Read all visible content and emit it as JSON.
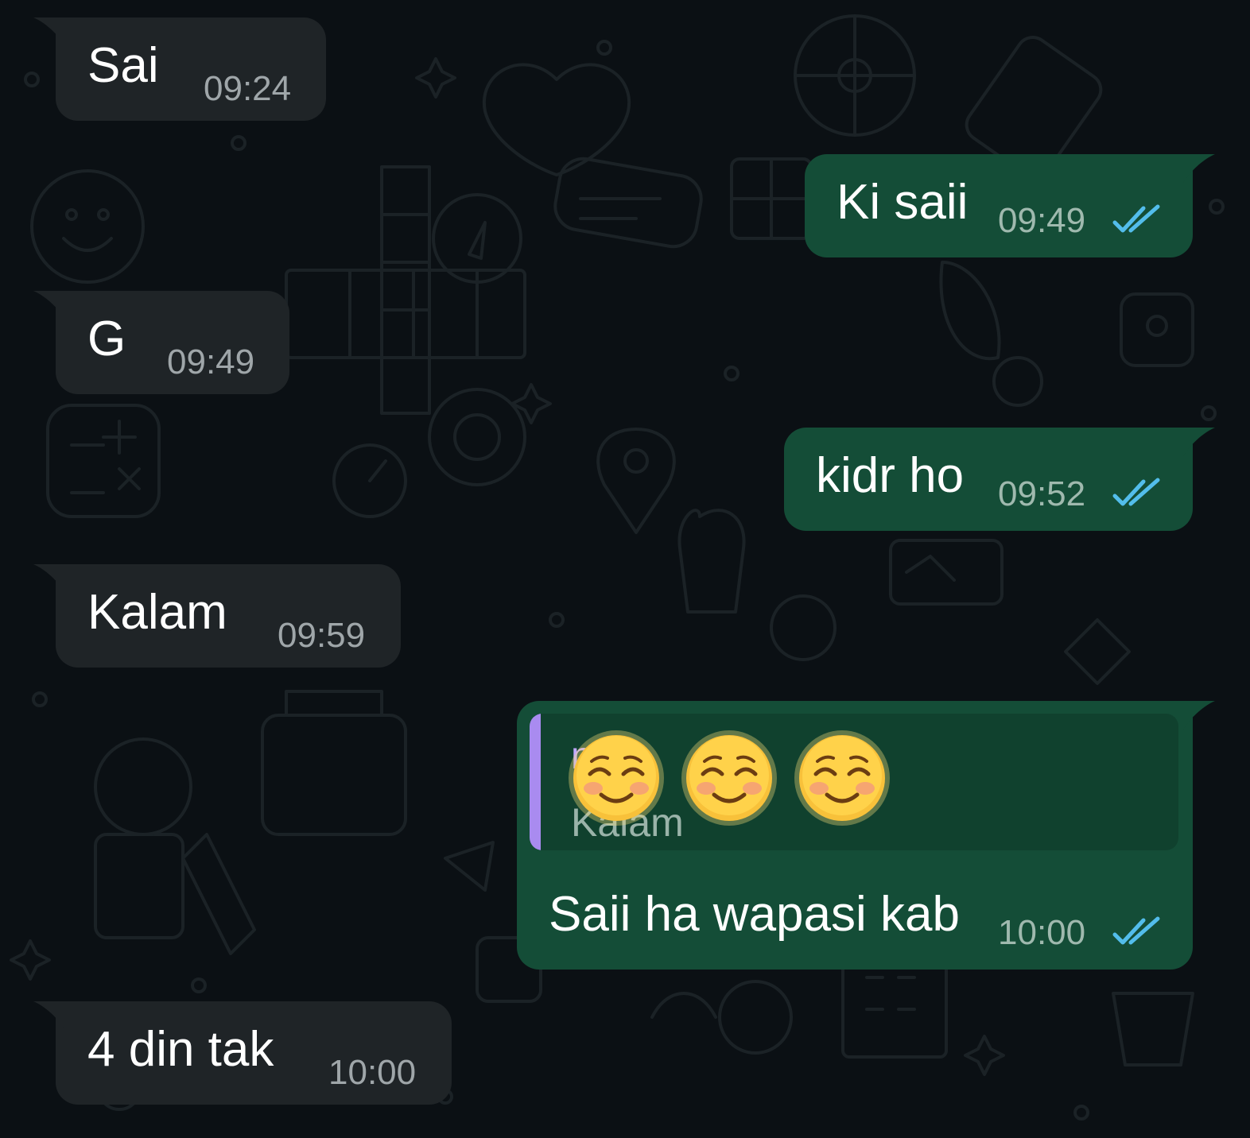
{
  "colors": {
    "background": "#0b1014",
    "incoming_bubble": "#1f2427",
    "outgoing_bubble": "#144d37",
    "read_ticks": "#53bdeb",
    "quote_bar": "#a98bf0"
  },
  "messages": [
    {
      "direction": "incoming",
      "text": "Sai",
      "time": "09:24"
    },
    {
      "direction": "outgoing",
      "text": "Ki saii",
      "time": "09:49",
      "status": "read-double-check-icon"
    },
    {
      "direction": "incoming",
      "text": "G",
      "time": "09:49"
    },
    {
      "direction": "outgoing",
      "text": "kidr ho",
      "time": "09:52",
      "status": "read-double-check-icon"
    },
    {
      "direction": "incoming",
      "text": "Kalam",
      "time": "09:59"
    },
    {
      "direction": "outgoing",
      "text": "Saii ha wapasi kab",
      "time": "10:00",
      "status": "read-double-check-icon",
      "quoted": {
        "author": "n m",
        "text": "Kalam"
      },
      "emoji_overlay": [
        "smiling-face-emoji",
        "smiling-face-emoji",
        "smiling-face-emoji"
      ]
    },
    {
      "direction": "incoming",
      "text": "4 din tak",
      "time": "10:00"
    }
  ]
}
